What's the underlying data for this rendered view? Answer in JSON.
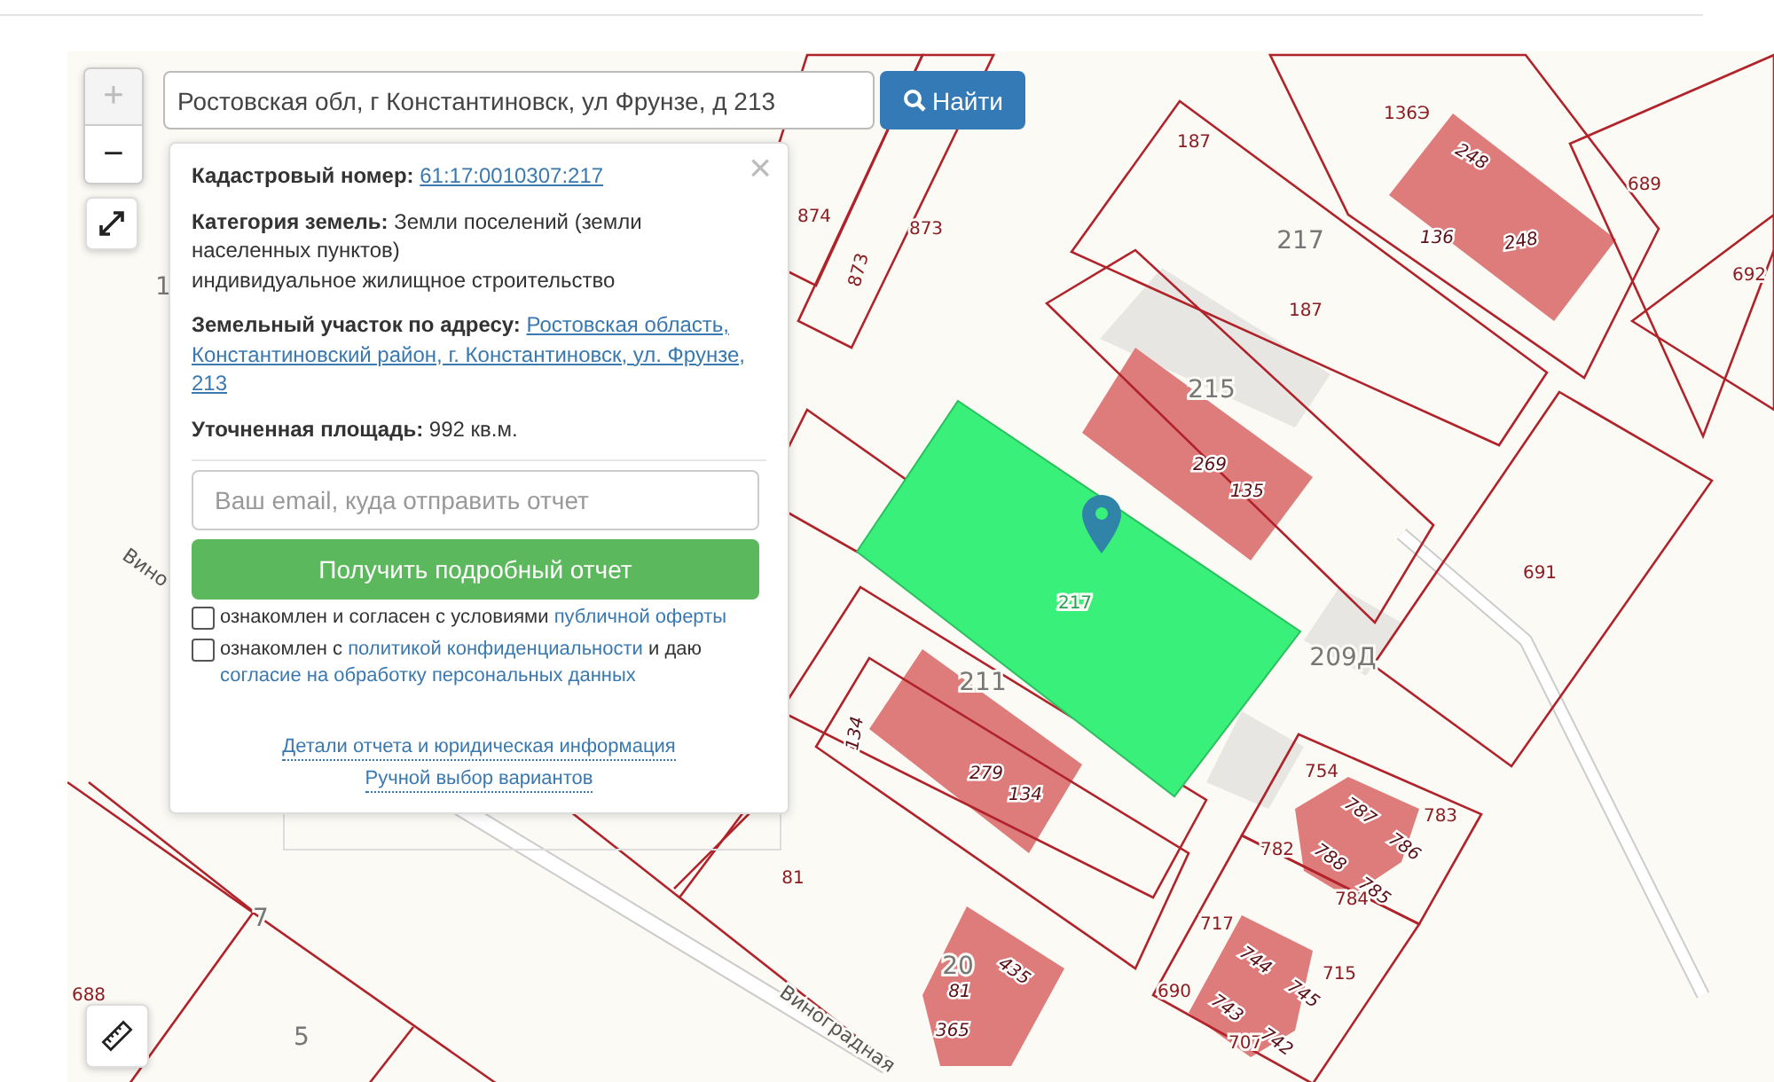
{
  "search": {
    "value": "Ростовская обл, г Константиновск, ул Фрунзе, д 213",
    "button": "Найти"
  },
  "zoom": {
    "plus": "+",
    "minus": "−"
  },
  "info": {
    "cadastral": {
      "label": "Кадастровый номер:",
      "link": "61:17:0010307:217"
    },
    "category": {
      "text": "**Категория земель:** Земли поселений (земли населенных пунктов)",
      "note": "индивидуальное жилищное строительство"
    },
    "address": {
      "label": "Земельный участок по адресу:",
      "link": "Ростовская область, Константиновский район, г. Константиновск, ул. Фрунзе, 213"
    },
    "area": {
      "text": "**Уточненная площадь:** 992 кв.м."
    },
    "close": "×",
    "email": {
      "placeholder": "Ваш email, куда отправить отчет"
    },
    "submit": "Получить подробный отчет",
    "agreements": [
      {
        "checked": false,
        "parts": [
          {
            "text": "ознакомлен и согласен с условиями",
            "kind": "text"
          },
          {
            "text": "публичной оферты",
            "kind": "link"
          }
        ]
      },
      {
        "checked": false,
        "parts": [
          {
            "text": "ознакомлен с",
            "kind": "text"
          },
          {
            "text": "политикой конфиденциальности",
            "kind": "link"
          },
          {
            "text": "и даю",
            "kind": "text"
          },
          {
            "text": "согласие на обработку персональных данных",
            "kind": "link"
          }
        ]
      }
    ],
    "footer_links": [
      "Детали отчета и юридическая информация",
      "Ручной выбор вариантов"
    ]
  },
  "map_labels": [
    {
      "text": "874",
      "kind": "parcel"
    },
    {
      "text": "873",
      "kind": "parcel"
    },
    {
      "text": "873",
      "kind": "parcel"
    },
    {
      "text": "187",
      "kind": "parcel"
    },
    {
      "text": "136Э",
      "kind": "parcel"
    },
    {
      "text": "248",
      "kind": "house"
    },
    {
      "text": "689",
      "kind": "parcel"
    },
    {
      "text": "217",
      "kind": "building"
    },
    {
      "text": "136",
      "kind": "house"
    },
    {
      "text": "248",
      "kind": "house"
    },
    {
      "text": "692",
      "kind": "parcel"
    },
    {
      "text": "187",
      "kind": "parcel"
    },
    {
      "text": "215",
      "kind": "building"
    },
    {
      "text": "269",
      "kind": "house"
    },
    {
      "text": "135",
      "kind": "house"
    },
    {
      "text": "691",
      "kind": "parcel"
    },
    {
      "text": "217",
      "kind": "selected"
    },
    {
      "text": "209Д",
      "kind": "building"
    },
    {
      "text": "211",
      "kind": "building"
    },
    {
      "text": "134",
      "kind": "house"
    },
    {
      "text": "279",
      "kind": "house"
    },
    {
      "text": "134",
      "kind": "house"
    },
    {
      "text": "754",
      "kind": "parcel"
    },
    {
      "text": "787",
      "kind": "house"
    },
    {
      "text": "783",
      "kind": "parcel"
    },
    {
      "text": "786",
      "kind": "house"
    },
    {
      "text": "782",
      "kind": "parcel"
    },
    {
      "text": "788",
      "kind": "house"
    },
    {
      "text": "785",
      "kind": "house"
    },
    {
      "text": "784",
      "kind": "parcel"
    },
    {
      "text": "717",
      "kind": "parcel"
    },
    {
      "text": "744",
      "kind": "house"
    },
    {
      "text": "715",
      "kind": "parcel"
    },
    {
      "text": "690",
      "kind": "parcel"
    },
    {
      "text": "745",
      "kind": "house"
    },
    {
      "text": "743",
      "kind": "house"
    },
    {
      "text": "707",
      "kind": "parcel"
    },
    {
      "text": "742",
      "kind": "house"
    },
    {
      "text": "81",
      "kind": "parcel"
    },
    {
      "text": "20",
      "kind": "building"
    },
    {
      "text": "435",
      "kind": "house"
    },
    {
      "text": "81",
      "kind": "house"
    },
    {
      "text": "365",
      "kind": "house"
    },
    {
      "text": "7",
      "kind": "building"
    },
    {
      "text": "5",
      "kind": "building"
    },
    {
      "text": "688",
      "kind": "parcel"
    },
    {
      "text": "1",
      "kind": "building"
    },
    {
      "text": "Виноградная",
      "kind": "street"
    },
    {
      "text": "Вино",
      "kind": "street"
    }
  ]
}
